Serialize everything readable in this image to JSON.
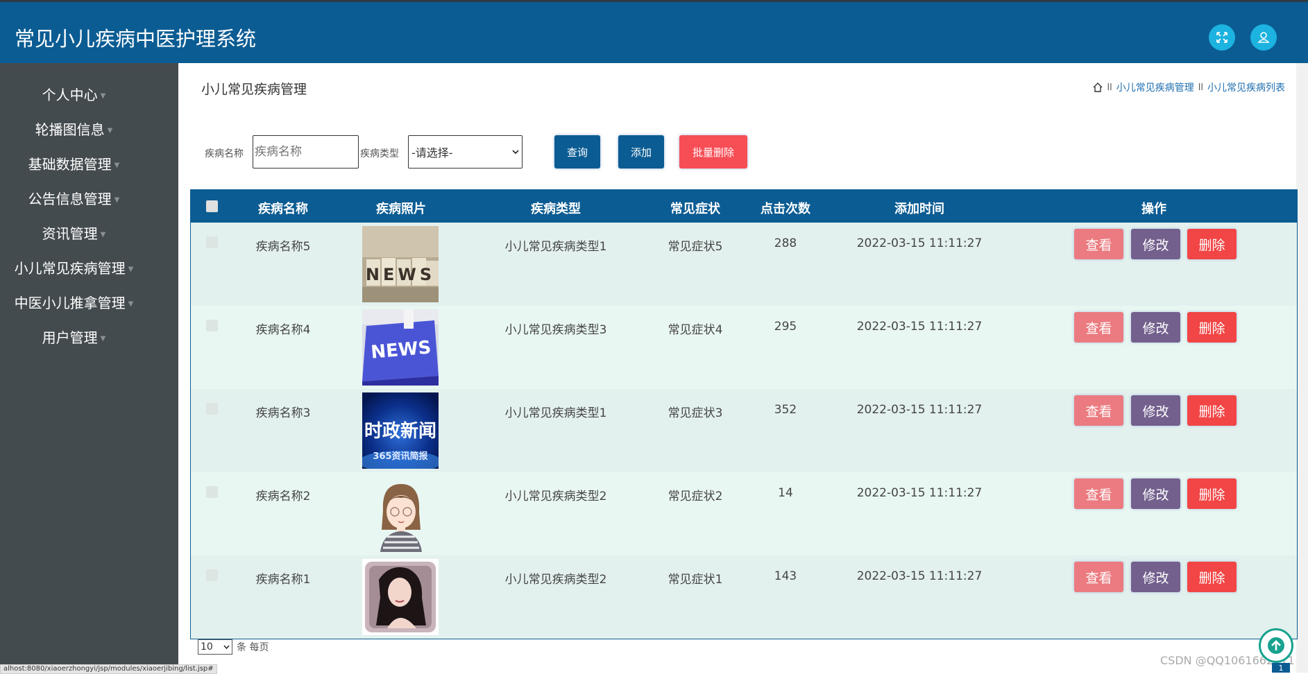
{
  "app": {
    "title": "常见小儿疾病中医护理系统"
  },
  "header_icons": [
    "fullscreen-icon",
    "user-icon"
  ],
  "sidebar": {
    "items": [
      {
        "label": "个人中心"
      },
      {
        "label": "轮播图信息"
      },
      {
        "label": "基础数据管理"
      },
      {
        "label": "公告信息管理"
      },
      {
        "label": "资讯管理"
      },
      {
        "label": "小儿常见疾病管理"
      },
      {
        "label": "中医小儿推拿管理"
      },
      {
        "label": "用户管理"
      }
    ]
  },
  "page": {
    "title": "小儿常见疾病管理",
    "breadcrumb": {
      "sep": "ll",
      "items": [
        "小儿常见疾病管理",
        "小儿常见疾病列表"
      ]
    }
  },
  "filters": {
    "name_label": "疾病名称",
    "name_placeholder": "疾病名称",
    "type_label": "疾病类型",
    "type_selected": "-请选择-",
    "query_btn": "查询",
    "add_btn": "添加",
    "batch_delete_btn": "批量删除"
  },
  "table": {
    "headers": [
      "疾病名称",
      "疾病照片",
      "疾病类型",
      "常见症状",
      "点击次数",
      "添加时间",
      "操作"
    ],
    "action_labels": {
      "view": "查看",
      "edit": "修改",
      "delete": "删除"
    },
    "rows": [
      {
        "name": "疾病名称5",
        "photo": "news-blocks-image",
        "type": "小儿常见疾病类型1",
        "symptom": "常见症状5",
        "clicks": "288",
        "time": "2022-03-15 11:11:27"
      },
      {
        "name": "疾病名称4",
        "photo": "news-keyboard-image",
        "type": "小儿常见疾病类型3",
        "symptom": "常见症状4",
        "clicks": "295",
        "time": "2022-03-15 11:11:27"
      },
      {
        "name": "疾病名称3",
        "photo": "shizheng-xinwen-image",
        "type": "小儿常见疾病类型1",
        "symptom": "常见症状3",
        "clicks": "352",
        "time": "2022-03-15 11:11:27"
      },
      {
        "name": "疾病名称2",
        "photo": "cartoon-girl-image",
        "type": "小儿常见疾病类型2",
        "symptom": "常见症状2",
        "clicks": "14",
        "time": "2022-03-15 11:11:27"
      },
      {
        "name": "疾病名称1",
        "photo": "woman-portrait-image",
        "type": "小儿常见疾病类型2",
        "symptom": "常见症状1",
        "clicks": "143",
        "time": "2022-03-15 11:11:27"
      }
    ],
    "image_texts": {
      "news": "NEWS",
      "shizheng": "时政新闻",
      "shizheng_sub": "365资讯简报"
    }
  },
  "pager": {
    "page_size": "10",
    "suffix": "条 每页",
    "current_page": "1"
  },
  "status_bar_url": "alhost:8080/xiaoerzhongyi/jsp/modules/xiaoerjibing/list.jsp#",
  "watermark": "CSDN @QQ1061662411",
  "colors": {
    "header": "#0b5c93",
    "sidebar": "#444b4f",
    "view_btn": "#eb7b80",
    "edit_btn": "#73608d",
    "delete_btn": "#f24545",
    "batch_delete_btn": "#f74d55"
  }
}
